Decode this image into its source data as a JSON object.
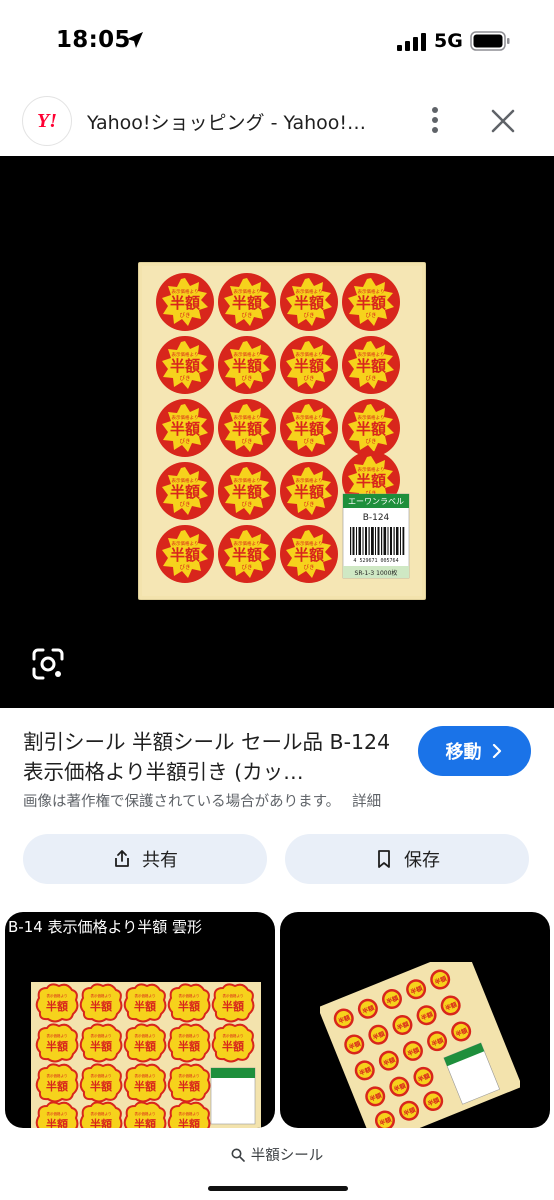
{
  "status": {
    "time": "18:05",
    "network": "5G"
  },
  "header": {
    "logo_text": "Y!",
    "title": "Yahoo!ショッピング - Yahoo!…"
  },
  "product": {
    "badge_small": "表示価格より",
    "badge_main": "半額",
    "badge_sub": "びき",
    "brand_label": "エーワンラベル",
    "model": "B-124",
    "barcode_number": "4 529671 005764",
    "bottom_code": "SR-1-3 1000枚"
  },
  "info": {
    "title": "割引シール 半額シール セール品 B-124 表示価格より半額引き (カッ…",
    "visit_label": "移動",
    "copyright": "画像は著作権で保護されている場合があります。",
    "details_label": "詳細"
  },
  "actions": {
    "share_label": "共有",
    "save_label": "保存"
  },
  "related": [
    {
      "caption": "B-14 表示価格より半額 雲形"
    },
    {
      "caption": ""
    }
  ],
  "bottom": {
    "search_query": "半額シール"
  },
  "colors": {
    "accent": "#1a73e8",
    "action_bg": "#e9eff8",
    "sticker_red": "#d8261c",
    "sticker_yellow": "#f6d21c",
    "sheet": "#f3e3ad"
  }
}
